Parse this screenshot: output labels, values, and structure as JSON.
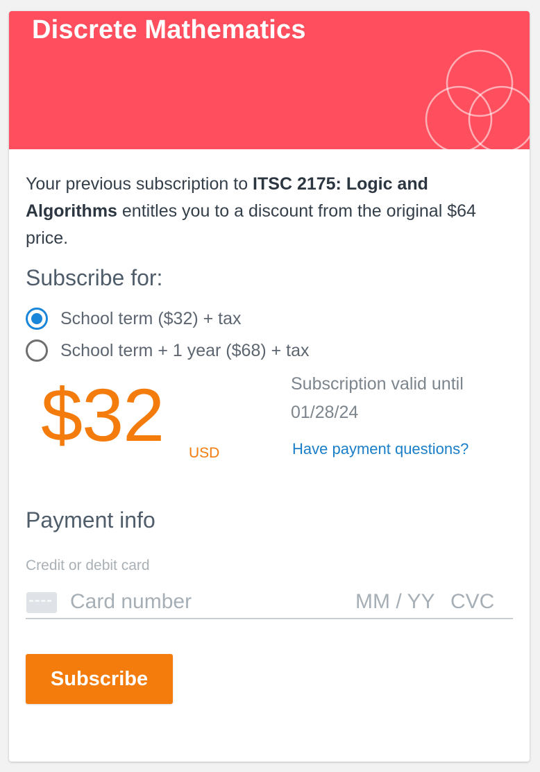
{
  "header": {
    "title": "Discrete Mathematics",
    "color": "#ff4f5e",
    "decoration_icon": "venn-diagram-icon"
  },
  "intro": {
    "prefix": "Your previous subscription to ",
    "course": "ITSC 2175: Logic and Algorithms",
    "suffix": " entitles you to a discount from the original $64 price."
  },
  "subscribe": {
    "title": "Subscribe for:",
    "options": [
      {
        "label": "School term ($32) + tax",
        "selected": true
      },
      {
        "label": "School term + 1 year ($68) + tax",
        "selected": false
      }
    ]
  },
  "price": {
    "amount": "$32",
    "currency": "USD",
    "accent": "#f37c0d"
  },
  "validity": {
    "label": "Subscription valid until",
    "date": "01/28/24"
  },
  "help_link": "Have payment questions?",
  "payment": {
    "title": "Payment info",
    "card_label": "Credit or debit card",
    "card_icon": "credit-card-icon",
    "card_number_placeholder": "Card number",
    "expiry_placeholder": "MM / YY",
    "cvc_placeholder": "CVC"
  },
  "subscribe_button": "Subscribe"
}
